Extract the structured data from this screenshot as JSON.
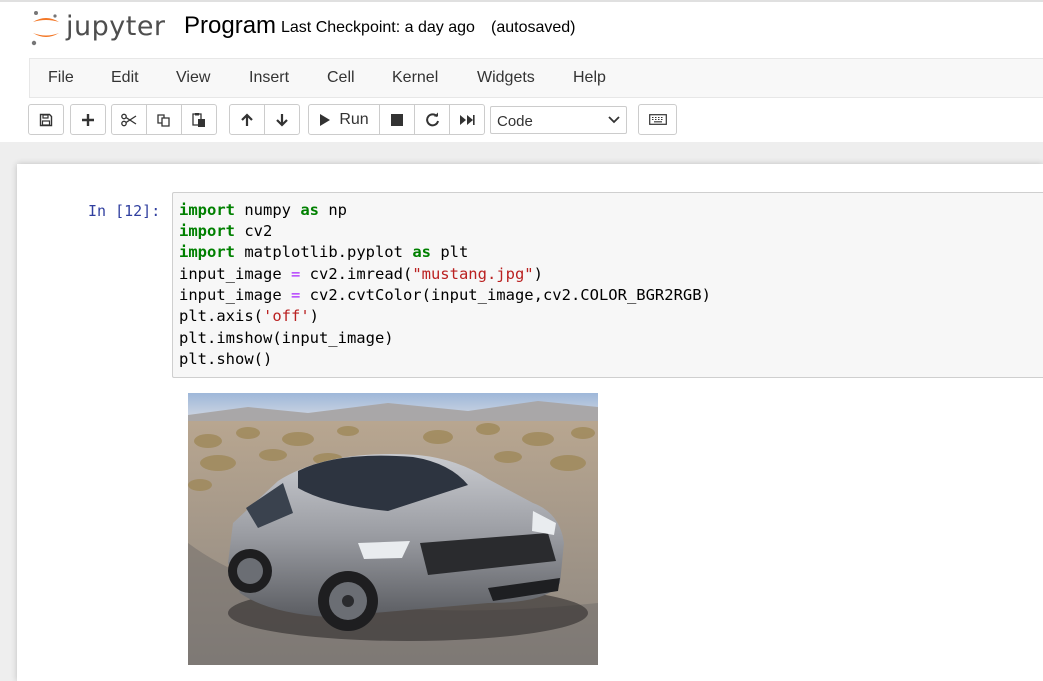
{
  "header": {
    "logo_text": "jupyter",
    "notebook_title": "Program",
    "checkpoint": "Last Checkpoint: a day ago",
    "autosave_status": "(autosaved)"
  },
  "menubar": {
    "items": [
      "File",
      "Edit",
      "View",
      "Insert",
      "Cell",
      "Kernel",
      "Widgets",
      "Help"
    ]
  },
  "toolbar": {
    "run_label": "Run",
    "cell_type": "Code",
    "icons": [
      "save-icon",
      "plus-icon",
      "scissors-icon",
      "copy-icon",
      "paste-icon",
      "arrow-up-icon",
      "arrow-down-icon",
      "play-icon",
      "stop-icon",
      "restart-icon",
      "fast-forward-icon",
      "keyboard-icon"
    ]
  },
  "cell": {
    "prompt": "In [12]:",
    "code_lines": [
      "import numpy as np",
      "import cv2",
      "import matplotlib.pyplot as plt",
      "input_image = cv2.imread(\"mustang.jpg\")",
      "input_image = cv2.cvtColor(input_image,cv2.COLOR_BGR2RGB)",
      "plt.axis('off')",
      "plt.imshow(input_image)",
      "plt.show()"
    ],
    "code_tokens": {
      "l1": [
        "import",
        " numpy ",
        "as",
        " np"
      ],
      "l2": [
        "import",
        " cv2"
      ],
      "l3": [
        "import",
        " matplotlib.pyplot ",
        "as",
        " plt"
      ],
      "l4": [
        "input_image ",
        "=",
        " cv2.imread(",
        "\"mustang.jpg\"",
        ")"
      ],
      "l5": [
        "input_image ",
        "=",
        " cv2.cvtColor(input_image,cv2.COLOR_BGR2RGB)"
      ],
      "l6": [
        "plt.axis(",
        "'off'",
        ")"
      ],
      "l7": [
        "plt.imshow(input_image)"
      ],
      "l8": [
        "plt.show()"
      ]
    },
    "output": {
      "kind": "image",
      "subject": "silver-ford-mustang"
    }
  },
  "colors": {
    "keyword": "#008000",
    "string": "#ba2121",
    "operator": "#aa22ff",
    "prompt": "#303f9f",
    "logo_orange": "#f37726",
    "code_bg": "#f7f7f7"
  }
}
